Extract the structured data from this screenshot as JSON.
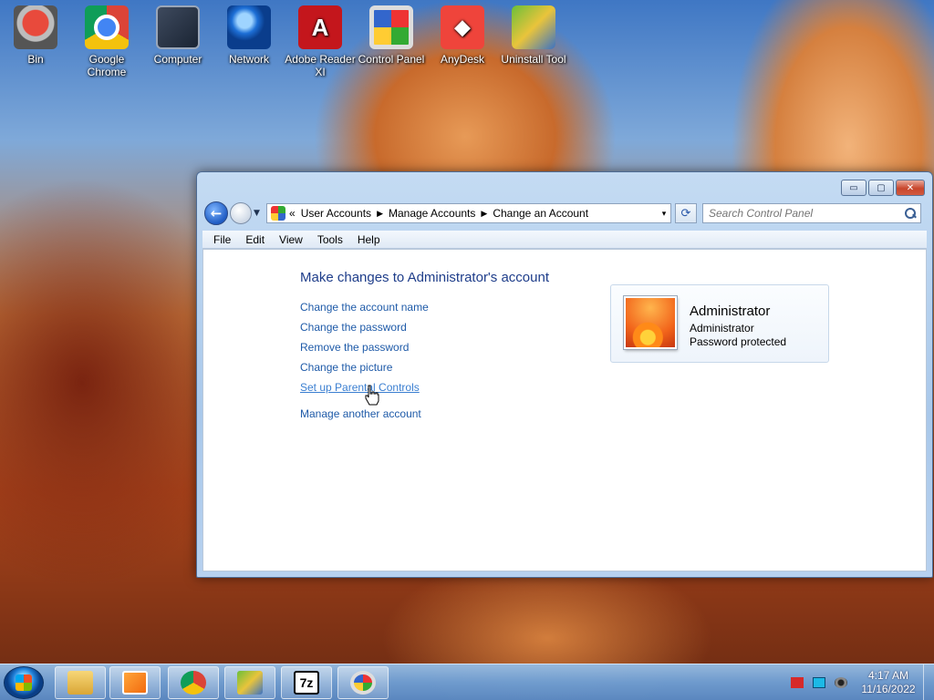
{
  "desktop": {
    "icons": [
      {
        "label": "Bin",
        "icon": "recycle-bin-icon"
      },
      {
        "label": "Google Chrome",
        "icon": "chrome-icon"
      },
      {
        "label": "Computer",
        "icon": "computer-icon"
      },
      {
        "label": "Network",
        "icon": "network-icon"
      },
      {
        "label": "Adobe Reader XI",
        "icon": "adobe-reader-icon"
      },
      {
        "label": "Control Panel",
        "icon": "control-panel-icon"
      },
      {
        "label": "AnyDesk",
        "icon": "anydesk-icon"
      },
      {
        "label": "Uninstall Tool",
        "icon": "uninstall-tool-icon"
      }
    ]
  },
  "window": {
    "controls": {
      "minimize": "▭",
      "maximize": "▢",
      "close": "✕"
    },
    "address": {
      "overflow": "«",
      "crumbs": [
        "User Accounts",
        "Manage Accounts",
        "Change an Account"
      ],
      "separator": "▶",
      "dropdown": "▾"
    },
    "refresh": "⟳",
    "search": {
      "placeholder": "Search Control Panel"
    },
    "menu": [
      "File",
      "Edit",
      "View",
      "Tools",
      "Help"
    ],
    "heading": "Make changes to Administrator's account",
    "tasks": [
      "Change the account name",
      "Change the password",
      "Remove the password",
      "Change the picture",
      "Set up Parental Controls"
    ],
    "other_task": "Manage another account",
    "account": {
      "name": "Administrator",
      "type": "Administrator",
      "status": "Password protected"
    }
  },
  "taskbar": {
    "clock": {
      "time": "4:17 AM",
      "date": "11/16/2022"
    },
    "seven_zip_label": "7z"
  },
  "colors": {
    "link": "#1e5aa8",
    "heading": "#1e3d8a"
  }
}
